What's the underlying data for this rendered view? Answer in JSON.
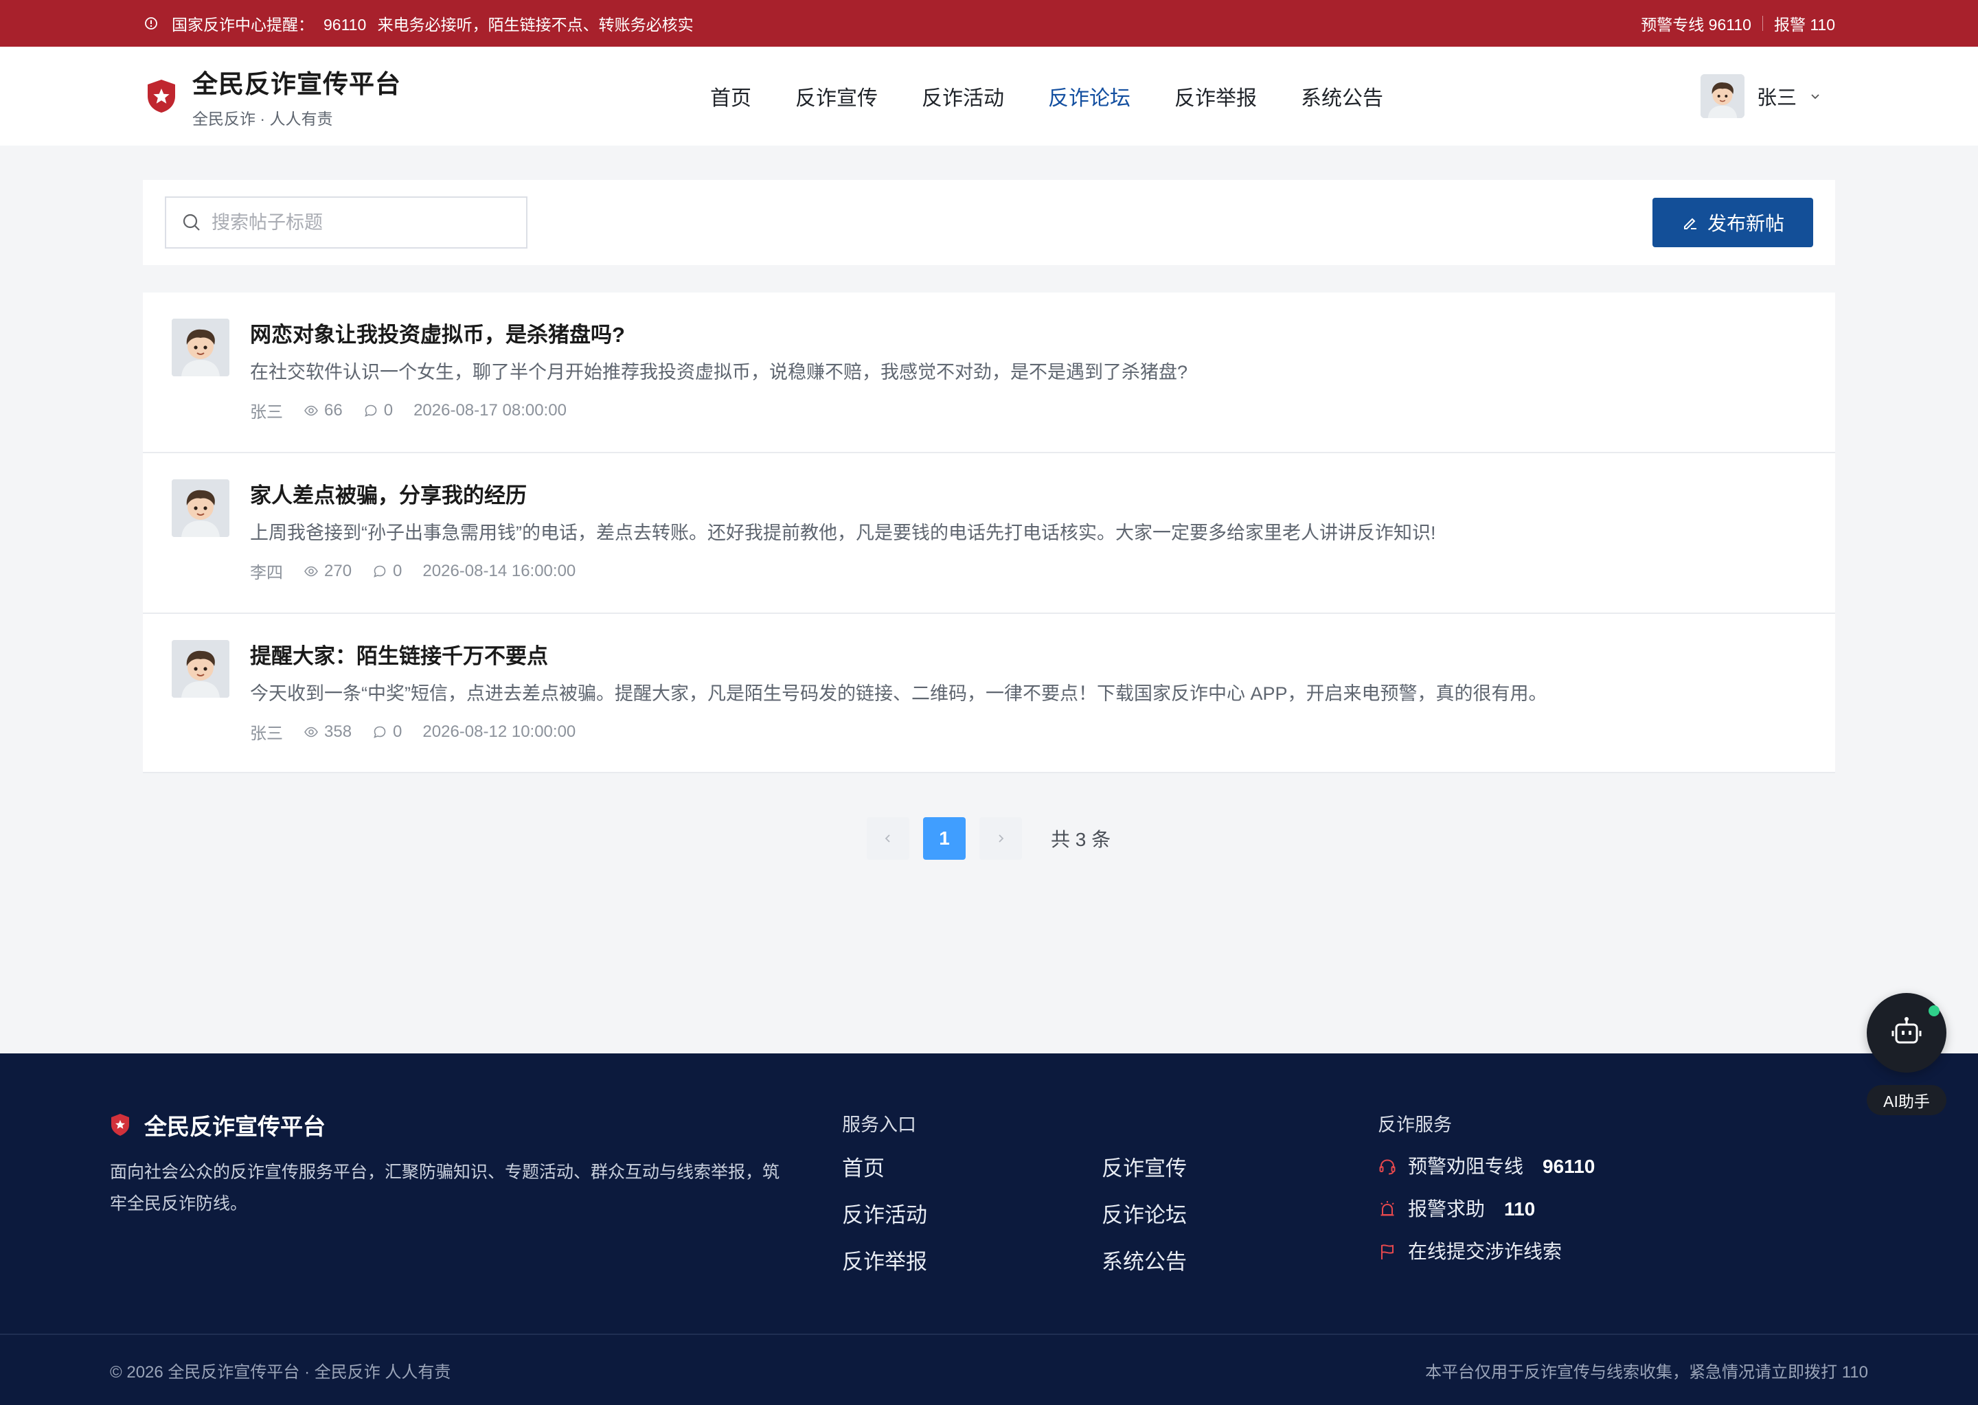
{
  "colors": {
    "alert_bg": "#a8212c",
    "primary": "#134f98",
    "nav_active": "#134fa0",
    "footer_bg": "#0c1a3d",
    "page_current": "#409eff"
  },
  "alert": {
    "icon": "info-circle-icon",
    "label": "国家反诈中心提醒：",
    "number": "96110",
    "message": "来电务必接听，陌生链接不点、转账务必核实",
    "hotline": "预警专线 96110",
    "police": "报警 110"
  },
  "header": {
    "logo_icon": "shield-star-icon",
    "name": "全民反诈宣传平台",
    "slogan": "全民反诈 · 人人有责",
    "nav": [
      {
        "label": "首页",
        "active": false
      },
      {
        "label": "反诈宣传",
        "active": false
      },
      {
        "label": "反诈活动",
        "active": false
      },
      {
        "label": "反诈论坛",
        "active": true
      },
      {
        "label": "反诈举报",
        "active": false
      },
      {
        "label": "系统公告",
        "active": false
      }
    ],
    "user": {
      "name": "张三",
      "dropdown_icon": "chevron-down-icon"
    }
  },
  "toolbar": {
    "search_placeholder": "搜索帖子标题",
    "publish_label": "发布新帖"
  },
  "posts": [
    {
      "title": "网恋对象让我投资虚拟币，是杀猪盘吗?",
      "excerpt": "在社交软件认识一个女生，聊了半个月开始推荐我投资虚拟币，说稳赚不赔，我感觉不对劲，是不是遇到了杀猪盘?",
      "author": "张三",
      "views": "66",
      "comments": "0",
      "time": "2026-08-17 08:00:00"
    },
    {
      "title": "家人差点被骗，分享我的经历",
      "excerpt": "上周我爸接到“孙子出事急需用钱”的电话，差点去转账。还好我提前教他，凡是要钱的电话先打电话核实。大家一定要多给家里老人讲讲反诈知识!",
      "author": "李四",
      "views": "270",
      "comments": "0",
      "time": "2026-08-14 16:00:00"
    },
    {
      "title": "提醒大家：陌生链接千万不要点",
      "excerpt": "今天收到一条“中奖”短信，点进去差点被骗。提醒大家，凡是陌生号码发的链接、二维码，一律不要点！下载国家反诈中心 APP，开启来电预警，真的很有用。",
      "author": "张三",
      "views": "358",
      "comments": "0",
      "time": "2026-08-12 10:00:00"
    }
  ],
  "pagination": {
    "current": "1",
    "total": "共 3 条"
  },
  "footer": {
    "name": "全民反诈宣传平台",
    "desc": "面向社会公众的反诈宣传服务平台，汇聚防骗知识、专题活动、群众互动与线索举报，筑牢全民反诈防线。",
    "links_title": "服务入口",
    "links": [
      "首页",
      "反诈宣传",
      "反诈活动",
      "反诈论坛",
      "反诈举报",
      "系统公告"
    ],
    "services_title": "反诈服务",
    "services": [
      {
        "icon": "headset-icon",
        "label": "预警劝阻专线",
        "value": "96110"
      },
      {
        "icon": "alarm-icon",
        "label": "报警求助",
        "value": "110"
      },
      {
        "icon": "flag-icon",
        "label": "在线提交涉诈线索",
        "value": ""
      }
    ],
    "copyright": "© 2026 全民反诈宣传平台 · 全民反诈 人人有责",
    "note": "本平台仅用于反诈宣传与线索收集，紧急情况请立即拨打 110"
  },
  "assistant": {
    "label": "AI助手",
    "icon": "robot-icon"
  }
}
